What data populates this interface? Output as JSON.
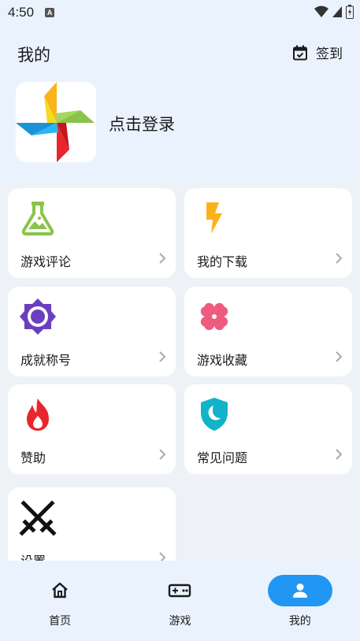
{
  "status_bar": {
    "time": "4:50",
    "notif_letter": "A"
  },
  "header": {
    "title": "我的",
    "checkin_label": "签到",
    "login_text": "点击登录"
  },
  "cards": [
    {
      "label": "游戏评论",
      "icon": "flask-icon",
      "color": "#8bc34a"
    },
    {
      "label": "我的下载",
      "icon": "lightning-icon",
      "color": "#fbb21a"
    },
    {
      "label": "成就称号",
      "icon": "settings-badge-icon",
      "color": "#6a3fbf"
    },
    {
      "label": "游戏收藏",
      "icon": "clover-icon",
      "color": "#ef5b7f"
    },
    {
      "label": "赞助",
      "icon": "fire-icon",
      "color": "#e8262d"
    },
    {
      "label": "常见问题",
      "icon": "moon-shield-icon",
      "color": "#11b3c9"
    },
    {
      "label": "设置",
      "icon": "crossed-swords-icon",
      "color": "#111111"
    }
  ],
  "nav": [
    {
      "label": "首页",
      "icon": "home-icon",
      "active": false
    },
    {
      "label": "游戏",
      "icon": "gamepad-icon",
      "active": false
    },
    {
      "label": "我的",
      "icon": "person-icon",
      "active": true
    }
  ]
}
